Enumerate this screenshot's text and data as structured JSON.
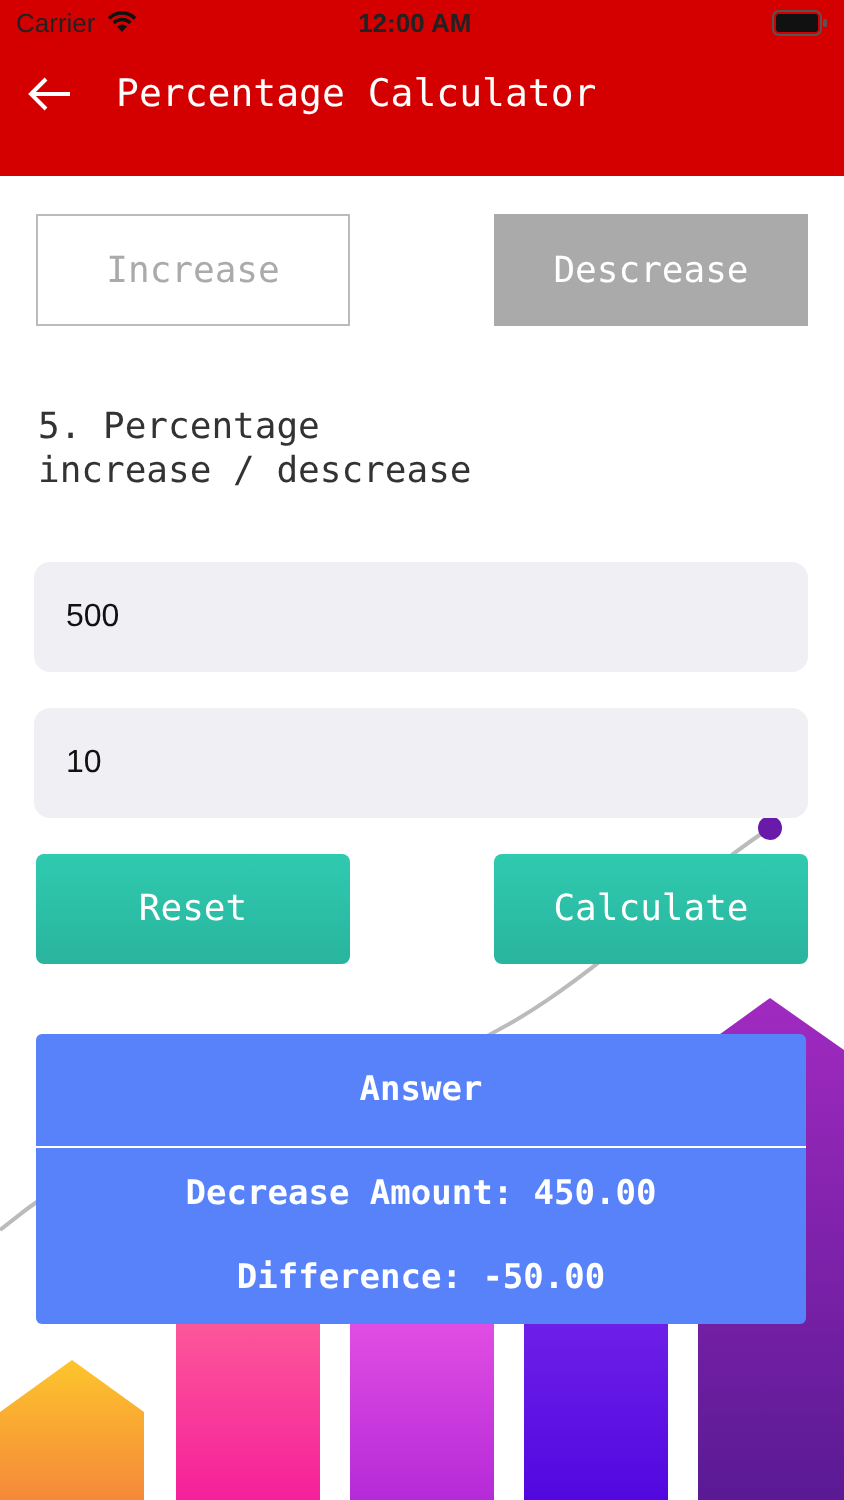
{
  "status_bar": {
    "carrier": "Carrier",
    "time": "12:00 AM"
  },
  "header": {
    "title": "Percentage Calculator"
  },
  "modes": [
    {
      "label": "Increase",
      "selected": false
    },
    {
      "label": "Descrease",
      "selected": true
    }
  ],
  "heading": "5. Percentage\nincrease / descrease",
  "fields": [
    {
      "value": "500"
    },
    {
      "value": "10"
    }
  ],
  "buttons": [
    {
      "label": "Reset"
    },
    {
      "label": "Calculate"
    }
  ],
  "answer": {
    "title": "Answer",
    "lines": [
      "Decrease Amount: 450.00",
      "Difference: -50.00"
    ]
  }
}
